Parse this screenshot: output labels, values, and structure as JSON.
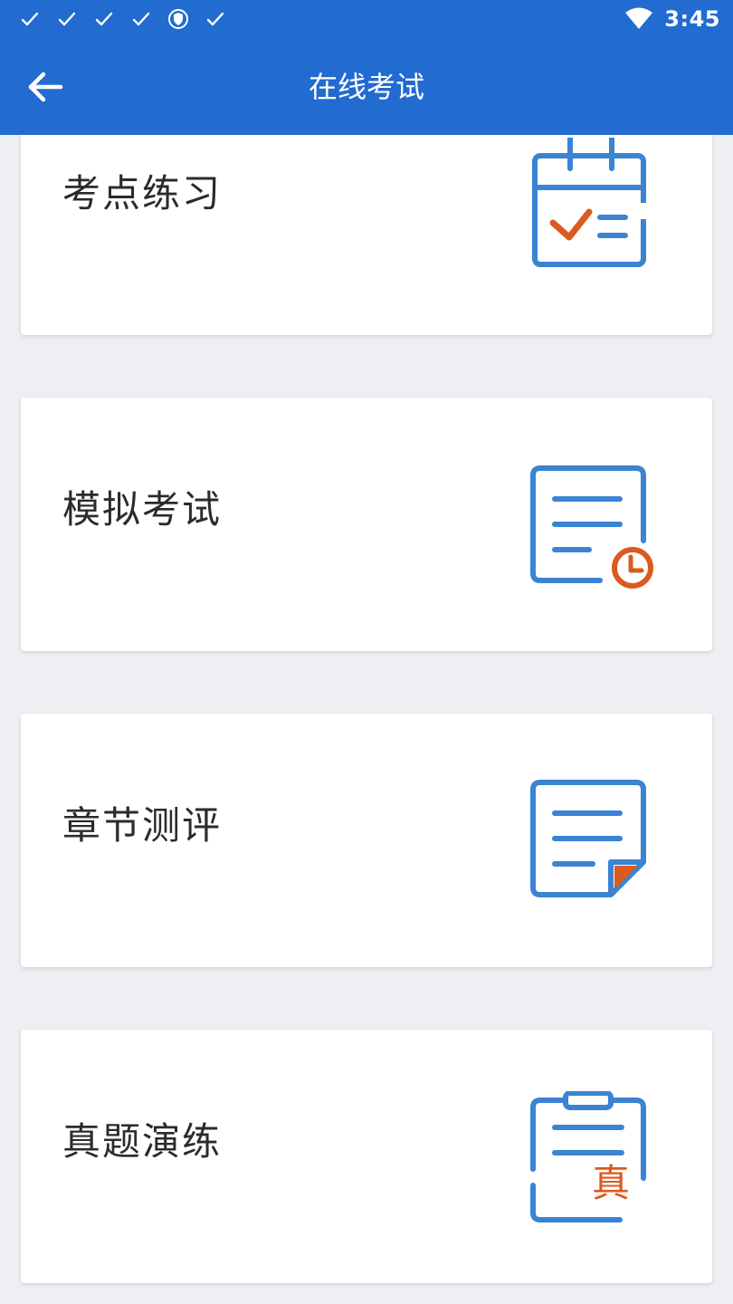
{
  "status_bar": {
    "time": "3:45",
    "notification_icons": [
      "check-icon",
      "check-icon",
      "check-icon",
      "check-icon",
      "shield-icon",
      "check-icon"
    ],
    "wifi_icon": "wifi-icon"
  },
  "toolbar": {
    "title": "在线考试",
    "back_icon": "arrow-left-icon"
  },
  "colors": {
    "primary": "#226bd0",
    "icon_blue": "#3b83d3",
    "icon_orange": "#db5a1e",
    "background": "#eeeff3"
  },
  "cards": [
    {
      "label": "考点练习",
      "icon": "calendar-check-icon"
    },
    {
      "label": "模拟考试",
      "icon": "document-clock-icon"
    },
    {
      "label": "章节测评",
      "icon": "document-folded-icon"
    },
    {
      "label": "真题演练",
      "icon": "clipboard-zhen-icon",
      "icon_text": "真"
    }
  ]
}
